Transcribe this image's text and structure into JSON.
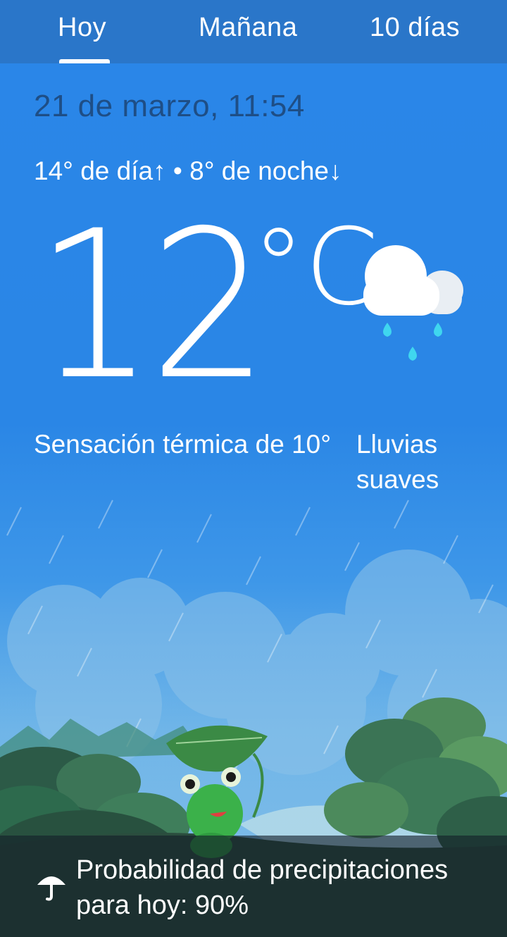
{
  "tabs": [
    {
      "label": "Hoy",
      "selected": true
    },
    {
      "label": "Mañana",
      "selected": false
    },
    {
      "label": "10 días",
      "selected": false
    }
  ],
  "date_time": "21 de marzo, 11:54",
  "high_low": "14° de día↑ • 8° de noche↓",
  "temperature": "12",
  "unit": "°C",
  "feels_like": "Sensación térmica de 10°",
  "condition": "Lluvias suaves",
  "weather_icon": "cloud-rain-icon",
  "precipitation": "Probabilidad de precipitaciones para hoy: 90%",
  "precipitation_icon": "umbrella-icon",
  "colors": {
    "sky": "#2a86e8",
    "tab_bar": "#2a76c9",
    "date_text": "#1e4e86",
    "rain_drop": "#3fd6ef"
  }
}
